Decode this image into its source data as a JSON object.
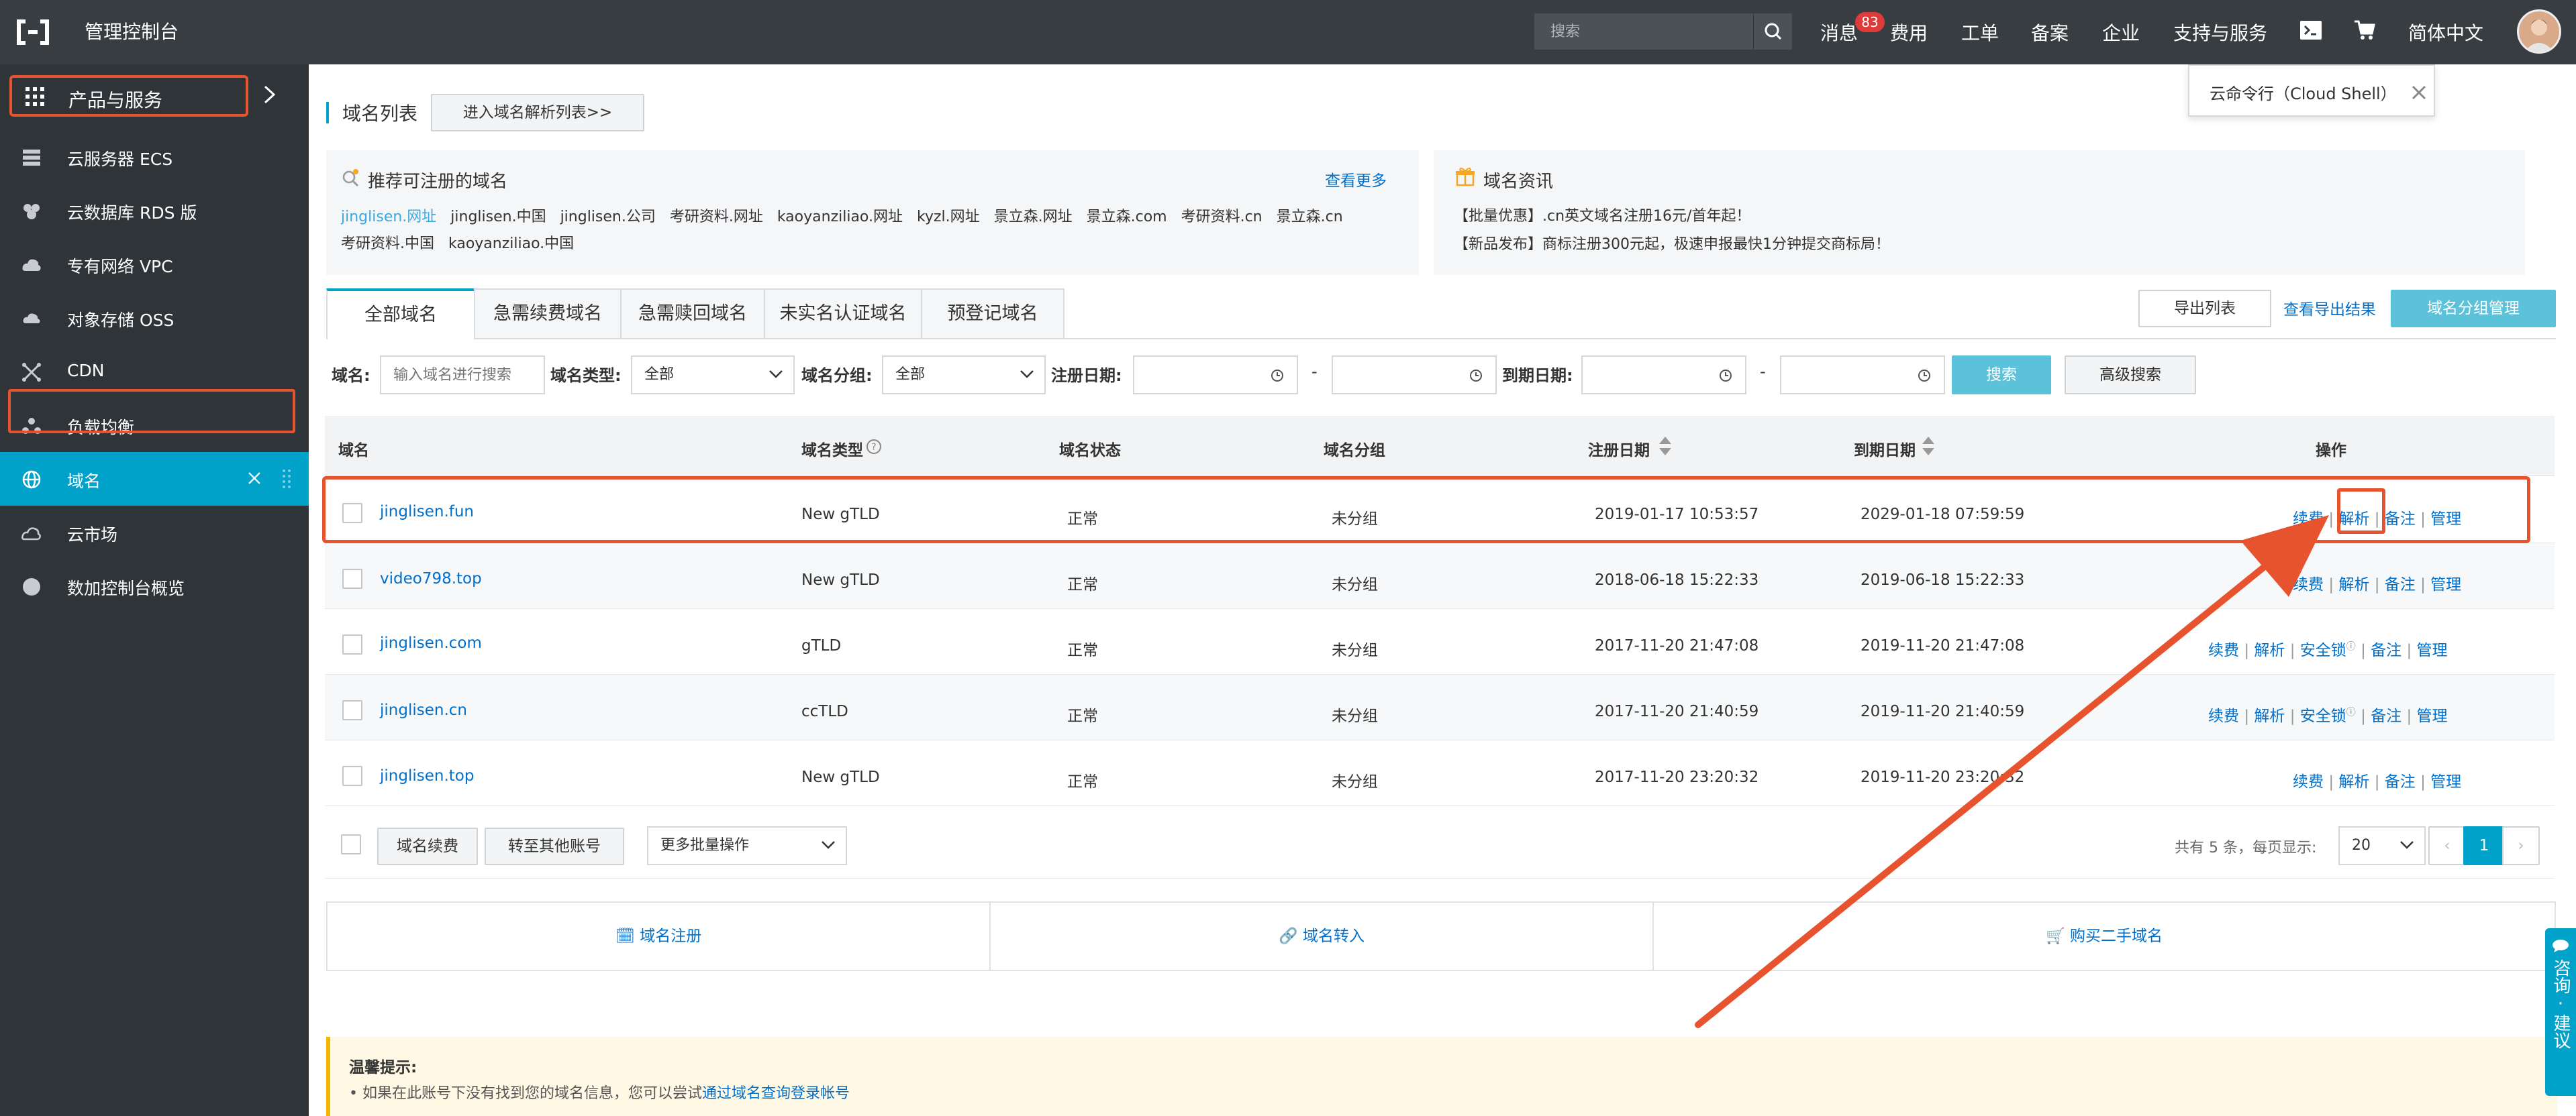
{
  "topbar": {
    "title": "管理控制台",
    "search_placeholder": "搜索",
    "nav": {
      "messages": "消息",
      "messages_count": "83",
      "fees": "费用",
      "tickets": "工单",
      "icp": "备案",
      "enterprise": "企业",
      "support": "支持与服务",
      "language": "简体中文"
    },
    "cloudshell_tip": "云命令行（Cloud Shell）"
  },
  "sidebar": {
    "header": "产品与服务",
    "items": [
      {
        "label": "云服务器 ECS",
        "icon": "server-icon"
      },
      {
        "label": "云数据库 RDS 版",
        "icon": "database-icon"
      },
      {
        "label": "专有网络 VPC",
        "icon": "cloud-network-icon"
      },
      {
        "label": "对象存储 OSS",
        "icon": "storage-icon"
      },
      {
        "label": "CDN",
        "icon": "cdn-icon"
      },
      {
        "label": "负载均衡",
        "icon": "load-balancer-icon"
      },
      {
        "label": "域名",
        "icon": "globe-icon"
      },
      {
        "label": "云市场",
        "icon": "market-icon"
      },
      {
        "label": "数加控制台概览",
        "icon": "dot-icon"
      }
    ]
  },
  "page": {
    "title": "域名列表",
    "parse_list_button": "进入域名解析列表>>"
  },
  "recommend": {
    "title": "推荐可注册的域名",
    "more": "查看更多",
    "line1": [
      "jinglisen.网址",
      "jinglisen.中国",
      "jinglisen.公司",
      "考研资料.网址",
      "kaoyanziliao.网址",
      "kyzl.网址",
      "景立森.网址",
      "景立森.com",
      "考研资料.cn",
      "景立森.cn"
    ],
    "line2": [
      "考研资料.中国",
      "kaoyanziliao.中国"
    ]
  },
  "news": {
    "title": "域名资讯",
    "items": [
      "【批量优惠】.cn英文域名注册16元/首年起！",
      "【新品发布】商标注册300元起，极速申报最快1分钟提交商标局！"
    ]
  },
  "tabs": [
    "全部域名",
    "急需续费域名",
    "急需赎回域名",
    "未实名认证域名",
    "预登记域名"
  ],
  "actions": {
    "export": "导出列表",
    "export_results": "查看导出结果",
    "group_manage": "域名分组管理"
  },
  "filters": {
    "domain_label": "域名:",
    "domain_placeholder": "输入域名进行搜索",
    "type_label": "域名类型:",
    "type_value": "全部",
    "group_label": "域名分组:",
    "group_value": "全部",
    "reg_date_label": "注册日期:",
    "expire_date_label": "到期日期:",
    "dash": "-",
    "search": "搜索",
    "advanced": "高级搜索"
  },
  "table": {
    "headers": {
      "domain": "域名",
      "type": "域名类型",
      "status": "域名状态",
      "group": "域名分组",
      "reg_date": "注册日期",
      "expire_date": "到期日期",
      "ops": "操作"
    },
    "rows": [
      {
        "domain": "jinglisen.fun",
        "type": "New gTLD",
        "status": "正常",
        "group": "未分组",
        "reg": "2019-01-17 10:53:57",
        "exp": "2029-01-18 07:59:59"
      },
      {
        "domain": "video798.top",
        "type": "New gTLD",
        "status": "正常",
        "group": "未分组",
        "reg": "2018-06-18 15:22:33",
        "exp": "2019-06-18 15:22:33"
      },
      {
        "domain": "jinglisen.com",
        "type": "gTLD",
        "status": "正常",
        "group": "未分组",
        "reg": "2017-11-20 21:47:08",
        "exp": "2019-11-20 21:47:08"
      },
      {
        "domain": "jinglisen.cn",
        "type": "ccTLD",
        "status": "正常",
        "group": "未分组",
        "reg": "2017-11-20 21:40:59",
        "exp": "2019-11-20 21:40:59"
      },
      {
        "domain": "jinglisen.top",
        "type": "New gTLD",
        "status": "正常",
        "group": "未分组",
        "reg": "2017-11-20 23:20:32",
        "exp": "2019-11-20 23:20:32"
      }
    ],
    "ops": {
      "renew": "续费",
      "parse": "解析",
      "lock": "安全锁",
      "remark": "备注",
      "manage": "管理",
      "sep": "|"
    }
  },
  "batch": {
    "renew": "域名续费",
    "transfer": "转至其他账号",
    "more": "更多批量操作",
    "total": "共有 5 条，每页显示:",
    "page_size": "20",
    "page": "1",
    "prev": "‹",
    "next": "›"
  },
  "cards": {
    "register": "域名注册",
    "transfer_in": "域名转入",
    "buy_second_hand": "购买二手域名"
  },
  "tip": {
    "title": "温馨提示:",
    "text_prefix": "• 如果在此账号下没有找到您的域名信息，您可以尝试",
    "link": "通过域名查询登录帐号"
  },
  "feedback": "咨询·建议",
  "colors": {
    "accent": "#00a2ca",
    "highlight": "#e8532f",
    "link": "#0070cc",
    "topbar": "#373d41",
    "sidebar": "#2e3438"
  }
}
